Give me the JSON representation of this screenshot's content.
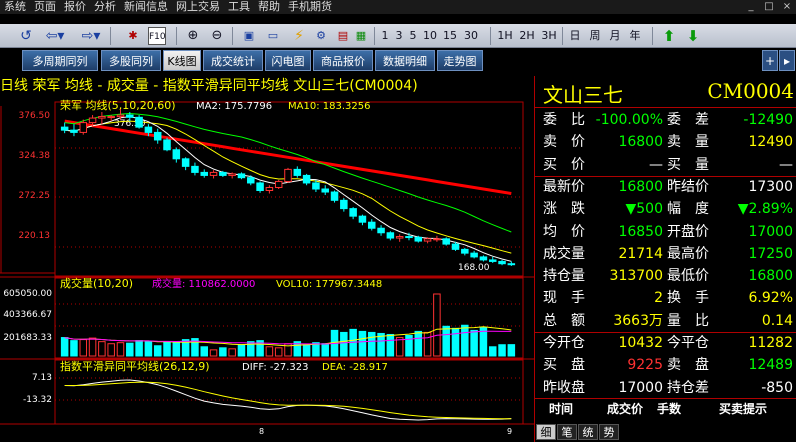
{
  "menu": [
    "系统",
    "页面",
    "报价",
    "分析",
    "新闻信息",
    "网上交易",
    "工具",
    "帮助",
    "手机期货"
  ],
  "window_buttons": [
    "_",
    "□",
    "×"
  ],
  "toolbar": {
    "periods": [
      "1",
      "3",
      "5",
      "10",
      "15",
      "30",
      "1H",
      "2H",
      "3H",
      "日",
      "周",
      "月",
      "年"
    ]
  },
  "tabs": [
    {
      "label": "多周期同列",
      "active": false
    },
    {
      "label": "多股同列",
      "active": false
    },
    {
      "label": "K线图",
      "active": true
    },
    {
      "label": "成交统计",
      "active": false
    },
    {
      "label": "闪电图",
      "active": false
    },
    {
      "label": "商品报价",
      "active": false
    },
    {
      "label": "数据明细",
      "active": false
    },
    {
      "label": "走势图",
      "active": false
    }
  ],
  "tab_scroll": [
    "+",
    "▸"
  ],
  "chart_header": {
    "text": "日线  荣军 均线 - 成交量 - 指数平滑异同平均线   文山三七(CM0004)"
  },
  "colors": {
    "ma5": "#ffffff",
    "ma10": "#ffff00",
    "ma20": "#00ff00",
    "ma60": "#ff0000",
    "up": "#ff3232",
    "down": "#00ffff",
    "grid": "#b00000",
    "red_value": "#ff3232",
    "green_value": "#00ff00",
    "yellow": "#ffff00",
    "magenta": "#ff00ff"
  },
  "price_panel": {
    "legend": "荣军 均线(5,10,20,60)",
    "ma2_label": "MA2: 175.7796",
    "ma10_label": "MA10: 183.3256",
    "y_ticks": [
      "376.50",
      "324.38",
      "272.25",
      "220.13"
    ],
    "ylim": [
      160,
      380
    ],
    "high_label": "376.50",
    "low_label": "168.00"
  },
  "volume_panel": {
    "legend_main": "成交量(10,20)",
    "legend_vol": "成交量: 110862.0000",
    "legend_vol10": "VOL10: 177967.3448",
    "y_ticks": [
      "605050.00",
      "403366.67",
      "201683.33"
    ],
    "ylim": [
      0,
      605050
    ]
  },
  "macd_panel": {
    "legend_main": "指数平滑异同平均线(26,12,9)",
    "legend_diff": "DIFF: -27.323",
    "legend_dea": "DEA: -28.917",
    "y_ticks": [
      "7.13",
      "-13.32"
    ]
  },
  "x_ticks": [
    "8",
    "9"
  ],
  "chart_data": {
    "type": "candlestick",
    "title": "日线 荣军 均线 - 成交量 - 指数平滑异同平均线 文山三七(CM0004)",
    "ylim": [
      160,
      380
    ],
    "candles": [
      {
        "o": 352,
        "h": 358,
        "l": 344,
        "c": 348
      },
      {
        "o": 348,
        "h": 356,
        "l": 340,
        "c": 345
      },
      {
        "o": 345,
        "h": 362,
        "l": 342,
        "c": 358
      },
      {
        "o": 358,
        "h": 368,
        "l": 352,
        "c": 364
      },
      {
        "o": 364,
        "h": 372,
        "l": 356,
        "c": 366
      },
      {
        "o": 366,
        "h": 368,
        "l": 360,
        "c": 366
      },
      {
        "o": 366,
        "h": 376,
        "l": 362,
        "c": 368
      },
      {
        "o": 368,
        "h": 372,
        "l": 360,
        "c": 365
      },
      {
        "o": 365,
        "h": 368,
        "l": 350,
        "c": 352
      },
      {
        "o": 352,
        "h": 356,
        "l": 340,
        "c": 345
      },
      {
        "o": 345,
        "h": 350,
        "l": 330,
        "c": 335
      },
      {
        "o": 335,
        "h": 338,
        "l": 320,
        "c": 322
      },
      {
        "o": 322,
        "h": 325,
        "l": 305,
        "c": 310
      },
      {
        "o": 310,
        "h": 312,
        "l": 295,
        "c": 300
      },
      {
        "o": 300,
        "h": 305,
        "l": 288,
        "c": 292
      },
      {
        "o": 292,
        "h": 296,
        "l": 285,
        "c": 288
      },
      {
        "o": 288,
        "h": 295,
        "l": 284,
        "c": 292
      },
      {
        "o": 292,
        "h": 294,
        "l": 286,
        "c": 288
      },
      {
        "o": 288,
        "h": 292,
        "l": 284,
        "c": 290
      },
      {
        "o": 290,
        "h": 292,
        "l": 283,
        "c": 285
      },
      {
        "o": 285,
        "h": 288,
        "l": 275,
        "c": 278
      },
      {
        "o": 278,
        "h": 280,
        "l": 265,
        "c": 268
      },
      {
        "o": 268,
        "h": 275,
        "l": 264,
        "c": 272
      },
      {
        "o": 272,
        "h": 282,
        "l": 270,
        "c": 280
      },
      {
        "o": 280,
        "h": 298,
        "l": 278,
        "c": 296
      },
      {
        "o": 296,
        "h": 300,
        "l": 285,
        "c": 288
      },
      {
        "o": 288,
        "h": 290,
        "l": 275,
        "c": 278
      },
      {
        "o": 278,
        "h": 282,
        "l": 266,
        "c": 270
      },
      {
        "o": 270,
        "h": 275,
        "l": 262,
        "c": 266
      },
      {
        "o": 266,
        "h": 268,
        "l": 252,
        "c": 255
      },
      {
        "o": 255,
        "h": 258,
        "l": 240,
        "c": 244
      },
      {
        "o": 244,
        "h": 246,
        "l": 230,
        "c": 234
      },
      {
        "o": 234,
        "h": 236,
        "l": 222,
        "c": 226
      },
      {
        "o": 226,
        "h": 230,
        "l": 215,
        "c": 218
      },
      {
        "o": 218,
        "h": 222,
        "l": 208,
        "c": 212
      },
      {
        "o": 212,
        "h": 214,
        "l": 202,
        "c": 205
      },
      {
        "o": 205,
        "h": 210,
        "l": 200,
        "c": 207
      },
      {
        "o": 207,
        "h": 212,
        "l": 202,
        "c": 206
      },
      {
        "o": 206,
        "h": 208,
        "l": 199,
        "c": 201
      },
      {
        "o": 201,
        "h": 206,
        "l": 198,
        "c": 204
      },
      {
        "o": 204,
        "h": 208,
        "l": 200,
        "c": 204
      },
      {
        "o": 204,
        "h": 206,
        "l": 195,
        "c": 197
      },
      {
        "o": 197,
        "h": 200,
        "l": 188,
        "c": 190
      },
      {
        "o": 190,
        "h": 192,
        "l": 182,
        "c": 185
      },
      {
        "o": 185,
        "h": 188,
        "l": 178,
        "c": 180
      },
      {
        "o": 180,
        "h": 182,
        "l": 174,
        "c": 176
      },
      {
        "o": 176,
        "h": 180,
        "l": 172,
        "c": 174
      },
      {
        "o": 174,
        "h": 176,
        "l": 169,
        "c": 171
      },
      {
        "o": 171,
        "h": 174,
        "l": 168,
        "c": 170
      }
    ],
    "volumes": [
      180000,
      150000,
      160000,
      175000,
      140000,
      120000,
      130000,
      125000,
      150000,
      145000,
      100000,
      140000,
      130000,
      160000,
      170000,
      90000,
      60000,
      80000,
      70000,
      110000,
      140000,
      150000,
      90000,
      80000,
      120000,
      140000,
      110000,
      130000,
      120000,
      250000,
      230000,
      260000,
      240000,
      230000,
      220000,
      210000,
      180000,
      200000,
      240000,
      230000,
      605050,
      290000,
      270000,
      300000,
      250000,
      280000,
      90000,
      110000,
      110862
    ],
    "ma60": [
      360,
      358,
      356,
      354,
      352,
      350,
      348,
      346,
      344,
      342,
      340,
      338,
      336,
      334,
      332,
      330,
      328,
      326,
      324,
      322,
      320,
      318,
      316,
      314,
      312,
      310,
      308,
      306,
      304,
      302,
      300,
      298,
      296,
      294,
      292,
      290,
      288,
      286,
      284,
      282,
      280,
      278,
      276,
      274,
      272,
      270,
      268,
      266,
      264
    ]
  },
  "quote": {
    "name": "文山三七",
    "code": "CM0004",
    "rows": [
      {
        "l1": "委　比",
        "v1": "-100.00%",
        "c1": "green",
        "l2": "委　差",
        "v2": "-12490",
        "c2": "green"
      },
      {
        "l1": "卖　价",
        "v1": "16800",
        "c1": "green",
        "l2": "卖　量",
        "v2": "12490",
        "c2": "yellow"
      },
      {
        "l1": "买　价",
        "v1": "—",
        "c1": "white",
        "l2": "买　量",
        "v2": "—",
        "c2": "white"
      },
      {
        "l1": "最新价",
        "v1": "16800",
        "c1": "green",
        "l2": "昨结价",
        "v2": "17300",
        "c2": "white"
      },
      {
        "l1": "涨　跌",
        "v1": "▼500",
        "c1": "green",
        "l2": "幅　度",
        "v2": "▼2.89%",
        "c2": "green"
      },
      {
        "l1": "均　价",
        "v1": "16850",
        "c1": "green",
        "l2": "开盘价",
        "v2": "17000",
        "c2": "green"
      },
      {
        "l1": "成交量",
        "v1": "21714",
        "c1": "yellow",
        "l2": "最高价",
        "v2": "17250",
        "c2": "green"
      },
      {
        "l1": "持仓量",
        "v1": "313700",
        "c1": "yellow",
        "l2": "最低价",
        "v2": "16800",
        "c2": "green"
      },
      {
        "l1": "现　手",
        "v1": "2",
        "c1": "yellow",
        "l2": "换　手",
        "v2": "6.92%",
        "c2": "yellow"
      },
      {
        "l1": "总　额",
        "v1": "3663万",
        "c1": "yellow",
        "l2": "量　比",
        "v2": "0.14",
        "c2": "yellow"
      },
      {
        "l1": "今开仓",
        "v1": "10432",
        "c1": "yellow",
        "l2": "今平仓",
        "v2": "11282",
        "c2": "yellow"
      },
      {
        "l1": "买　盘",
        "v1": "9225",
        "c1": "red",
        "l2": "卖　盘",
        "v2": "12489",
        "c2": "green"
      },
      {
        "l1": "昨收盘",
        "v1": "17000",
        "c1": "white",
        "l2": "持仓差",
        "v2": "-850",
        "c2": "white"
      }
    ],
    "trade_header": [
      "时间",
      "成交价",
      "手数",
      "买卖提示"
    ],
    "bottom_tabs": [
      "细",
      "笔",
      "统",
      "势"
    ]
  }
}
